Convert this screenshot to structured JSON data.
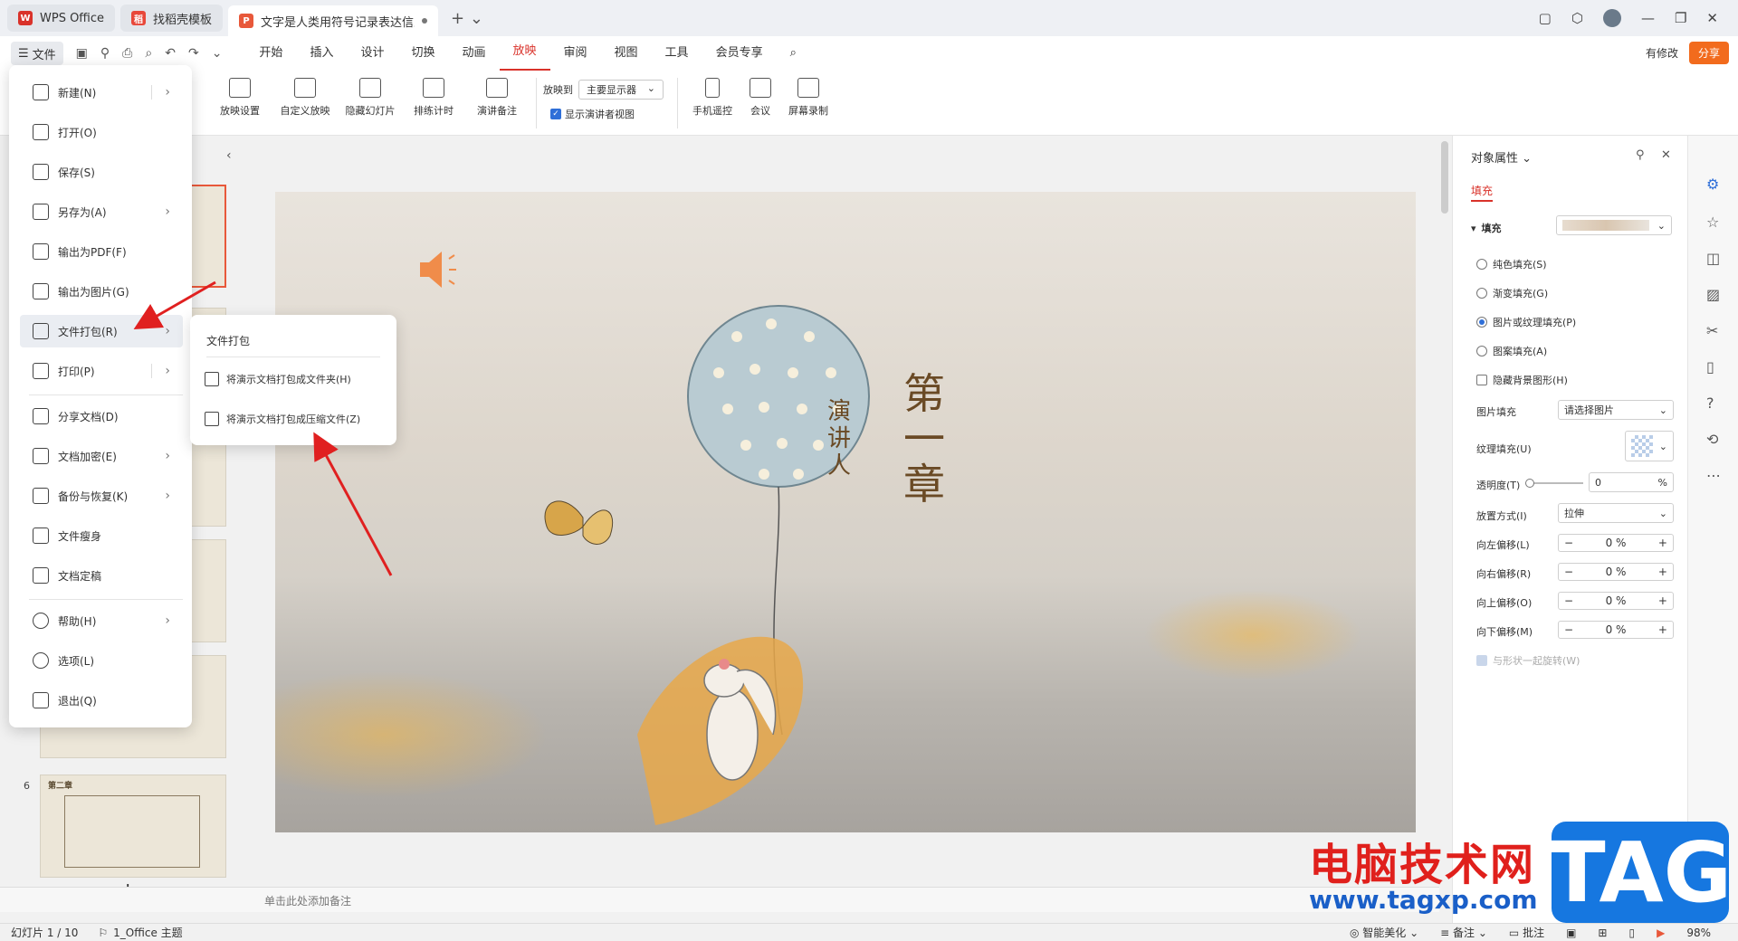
{
  "tabs": [
    {
      "label": "WPS Office"
    },
    {
      "label": "找稻壳模板"
    },
    {
      "label": "文字是人类用符号记录表达信息以"
    }
  ],
  "menu": {
    "file_label": "文件",
    "items": [
      "开始",
      "插入",
      "设计",
      "切换",
      "动画",
      "放映",
      "审阅",
      "视图",
      "工具",
      "会员专享"
    ],
    "active": "放映",
    "changes_label": "有修改",
    "share_label": "分享"
  },
  "ribbon": {
    "buttons": [
      "放映设置",
      "自定义放映",
      "隐藏幻灯片",
      "排练计时",
      "演讲备注",
      "手机遥控",
      "会议",
      "屏幕录制"
    ],
    "play_to_label": "放映到",
    "play_to_value": "主要显示器",
    "presenter_view_label": "显示演讲者视图"
  },
  "file_menu": {
    "items": [
      {
        "label": "新建(N)",
        "submenu": true
      },
      {
        "label": "打开(O)",
        "submenu": false
      },
      {
        "label": "保存(S)",
        "submenu": false
      },
      {
        "label": "另存为(A)",
        "submenu": true
      },
      {
        "label": "输出为PDF(F)",
        "submenu": false
      },
      {
        "label": "输出为图片(G)",
        "submenu": false
      },
      {
        "label": "文件打包(R)",
        "submenu": true
      },
      {
        "label": "打印(P)",
        "submenu": true
      },
      {
        "label": "分享文档(D)",
        "submenu": false
      },
      {
        "label": "文档加密(E)",
        "submenu": true
      },
      {
        "label": "备份与恢复(K)",
        "submenu": true
      },
      {
        "label": "文件瘦身",
        "submenu": false
      },
      {
        "label": "文档定稿",
        "submenu": false
      },
      {
        "label": "帮助(H)",
        "submenu": true
      },
      {
        "label": "选项(L)",
        "submenu": false
      },
      {
        "label": "退出(Q)",
        "submenu": false
      }
    ]
  },
  "package_submenu": {
    "title": "文件打包",
    "items": [
      "将演示文档打包成文件夹(H)",
      "将演示文档打包成压缩文件(Z)"
    ]
  },
  "thumbnails": {
    "visible_number": "6",
    "thumb6_title": "第二章"
  },
  "slide": {
    "title_chars": [
      "第",
      "一",
      "章"
    ],
    "speaker_chars": [
      "演",
      "讲",
      "人"
    ]
  },
  "notes_placeholder": "单击此处添加备注",
  "properties": {
    "header": "对象属性",
    "tab": "填充",
    "fill_label": "填充",
    "options": [
      {
        "label": "纯色填充(S)",
        "checked": false
      },
      {
        "label": "渐变填充(G)",
        "checked": false
      },
      {
        "label": "图片或纹理填充(P)",
        "checked": true
      },
      {
        "label": "图案填充(A)",
        "checked": false
      }
    ],
    "hide_bg_label": "隐藏背景图形(H)",
    "picture_fill_label": "图片填充",
    "picture_fill_value": "请选择图片",
    "texture_fill_label": "纹理填充(U)",
    "transparency_label": "透明度(T)",
    "transparency_value": "0",
    "transparency_unit": "%",
    "placement_label": "放置方式(I)",
    "placement_value": "拉伸",
    "offsets": [
      {
        "label": "向左偏移(L)",
        "value": "0 %"
      },
      {
        "label": "向右偏移(R)",
        "value": "0 %"
      },
      {
        "label": "向上偏移(O)",
        "value": "0 %"
      },
      {
        "label": "向下偏移(M)",
        "value": "0 %"
      }
    ],
    "rotate_label": "与形状一起旋转(W)"
  },
  "status": {
    "slide_info": "幻灯片 1 / 10",
    "theme": "1_Office 主题",
    "beautify": "智能美化",
    "notes": "备注",
    "comments": "批注",
    "zoom": "98%"
  },
  "watermark": {
    "text": "电脑技术网",
    "url": "www.tagxp.com",
    "tag": "TAG"
  }
}
